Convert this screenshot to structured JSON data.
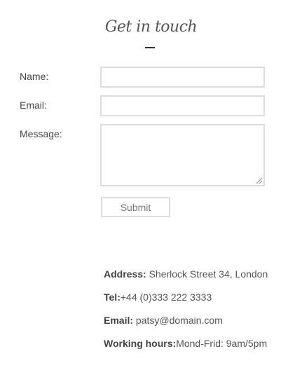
{
  "form": {
    "title": "Get in touch",
    "name_label": "Name:",
    "name_value": "",
    "email_label": "Email:",
    "email_value": "",
    "message_label": "Message:",
    "message_value": "",
    "submit_label": "Submit"
  },
  "contact": {
    "address_label": "Address:",
    "address_value": " Sherlock Street 34, London",
    "tel_label": "Tel:",
    "tel_value": "+44 (0)333 222 3333",
    "email_label": "Email:",
    "email_value": " patsy@domain.com",
    "hours_label": "Working hours:",
    "hours_value": "Mond-Frid: 9am/5pm"
  }
}
